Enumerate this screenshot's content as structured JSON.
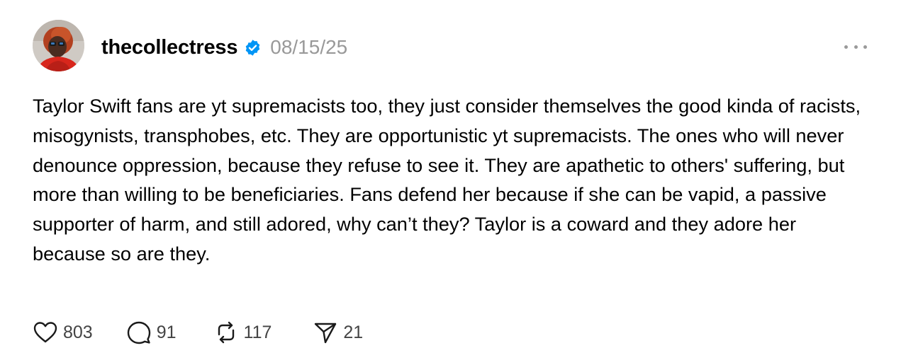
{
  "post": {
    "author": {
      "username": "thecollectress",
      "verified": true,
      "avatar_icon": "profile-photo"
    },
    "timestamp": "08/15/25",
    "more_icon": "ellipsis-icon",
    "text": "Taylor Swift fans are yt supremacists too, they just consider themselves the good kinda of racists, misogynists, transphobes, etc. They are opportunistic yt supremacists. The ones who will never denounce oppression, because they refuse to see it. They are apathetic to others' suffering, but more than willing to be beneficiaries. Fans defend her because if she can be vapid, a passive supporter of harm, and still adored, why can’t they? Taylor is a coward and they adore her because so are they.",
    "actions": {
      "likes": "803",
      "replies": "91",
      "reposts": "117",
      "shares": "21"
    }
  },
  "colors": {
    "text": "#000000",
    "muted": "#999999",
    "verified": "#0095f6",
    "icon": "#444444"
  }
}
